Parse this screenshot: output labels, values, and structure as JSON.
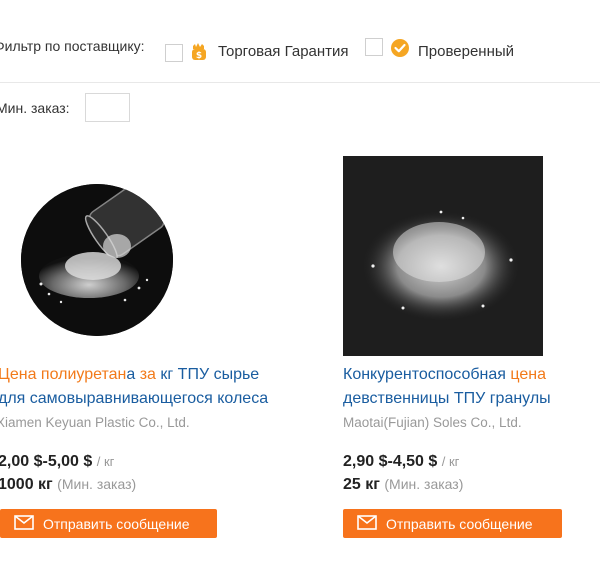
{
  "filter": {
    "label": "Фильтр по поставщику:",
    "options": [
      {
        "label": "Торговая Гарантия",
        "icon": "trade-assurance-icon",
        "checked": false
      },
      {
        "label": "Проверенный",
        "icon": "verified-supplier-icon",
        "checked": false
      }
    ]
  },
  "min_order": {
    "label": "Мин. заказ:",
    "value": ""
  },
  "colors": {
    "accent": "#f7731c",
    "link": "#1a5da0",
    "highlight": "#f27a1a",
    "muted": "#999999"
  },
  "products": [
    {
      "title_parts": [
        {
          "text": "Цена полиуретан",
          "hl": true
        },
        {
          "text": "а ",
          "hl": false
        },
        {
          "text": "за",
          "hl": true
        },
        {
          "text": " кг ТПУ сырье",
          "hl": false
        }
      ],
      "title_line2": "для самовыравнивающегося колеса",
      "company": "Xiamen Keyuan Plastic Co., Ltd.",
      "price": "2,00 $-5,00 $",
      "unit": "/ кг",
      "moq": "1000 кг",
      "moq_note": "(Мин. заказ)",
      "button": "Отправить сообщение",
      "image_icon": "tpu-pellets-jar-image"
    },
    {
      "title_parts": [
        {
          "text": "Конкурентоспособная ",
          "hl": false
        },
        {
          "text": "цена",
          "hl": true
        }
      ],
      "title_line2": "девственницы ТПУ гранулы",
      "company": "Maotai(Fujian) Soles Co., Ltd.",
      "price": "2,90 $-4,50 $",
      "unit": "/ кг",
      "moq": "25 кг",
      "moq_note": "(Мин. заказ)",
      "button": "Отправить сообщение",
      "image_icon": "tpu-granules-pile-image"
    }
  ]
}
